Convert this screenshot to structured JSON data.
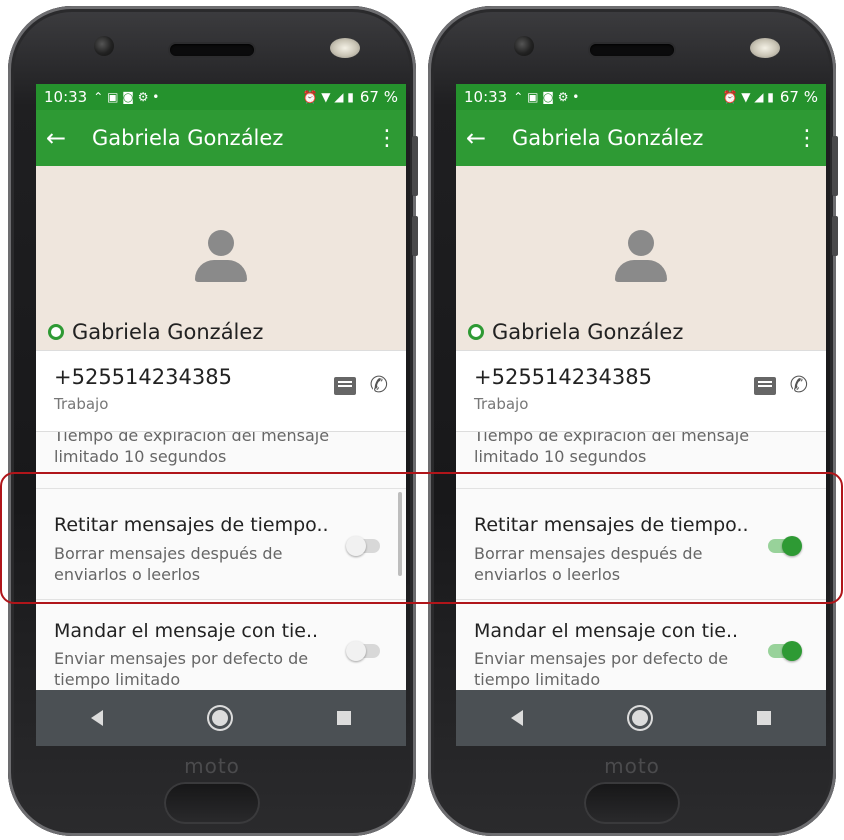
{
  "status_bar": {
    "time": "10:33",
    "battery": "67 %"
  },
  "app_bar": {
    "title": "Gabriela González"
  },
  "profile": {
    "name": "Gabriela González"
  },
  "contact": {
    "phone_number": "+525514234385",
    "phone_label": "Trabajo"
  },
  "settings": {
    "expiration_title": "Tiempo de expiración del mensaje",
    "expiration_value": "limitado 10 segundos",
    "retire_title": "Retitar mensajes de tiempo..",
    "retire_desc": "Borrar mensajes después de enviarlos o leerlos",
    "send_title": "Mandar el mensaje con tie..",
    "send_desc": "Enviar mensajes por defecto de tiempo limitado"
  },
  "brand": "moto",
  "phones": [
    {
      "state": "before",
      "retire_toggle": "off",
      "send_toggle": "off"
    },
    {
      "state": "after",
      "retire_toggle": "on",
      "send_toggle": "on"
    }
  ],
  "colors": {
    "primary": "#2e9a34",
    "status_bar": "#25922d",
    "highlight": "#b0151a",
    "hero_bg": "#efe6dd"
  }
}
